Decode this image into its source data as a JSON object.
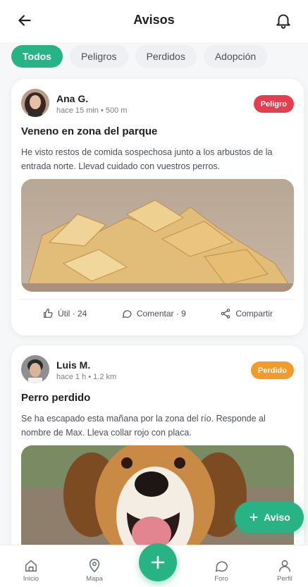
{
  "header": {
    "title": "Avisos"
  },
  "filters": [
    {
      "label": "Todos",
      "active": true
    },
    {
      "label": "Peligros",
      "active": false
    },
    {
      "label": "Perdidos",
      "active": false
    },
    {
      "label": "Adopción",
      "active": false
    }
  ],
  "posts": [
    {
      "author": "Ana G.",
      "meta": "hace 15 min • 500 m",
      "badge": "Peligro",
      "title": "Veneno en zona del parque",
      "body": "He visto restos de comida sospechosa junto a los arbustos de la entrada norte. Llevad cuidado con vuestros perros.",
      "actions": {
        "useful": "Útil · 24",
        "comment": "Comentar · 9",
        "share": "Compartir"
      }
    },
    {
      "author": "Luis M.",
      "meta": "hace 1 h • 1.2 km",
      "badge": "Perdido",
      "title": "Perro perdido",
      "body": "Se ha escapado esta mañana por la zona del río. Responde al nombre de Max. Lleva collar rojo con placa."
    }
  ],
  "fab": {
    "label": "Aviso"
  },
  "bottom_nav": [
    {
      "label": "Inicio"
    },
    {
      "label": "Mapa"
    },
    {
      "label": "Foro"
    },
    {
      "label": "Perfil"
    }
  ],
  "colors": {
    "accent": "#27b383",
    "danger": "#e53e4e",
    "warning": "#f29a2a"
  }
}
